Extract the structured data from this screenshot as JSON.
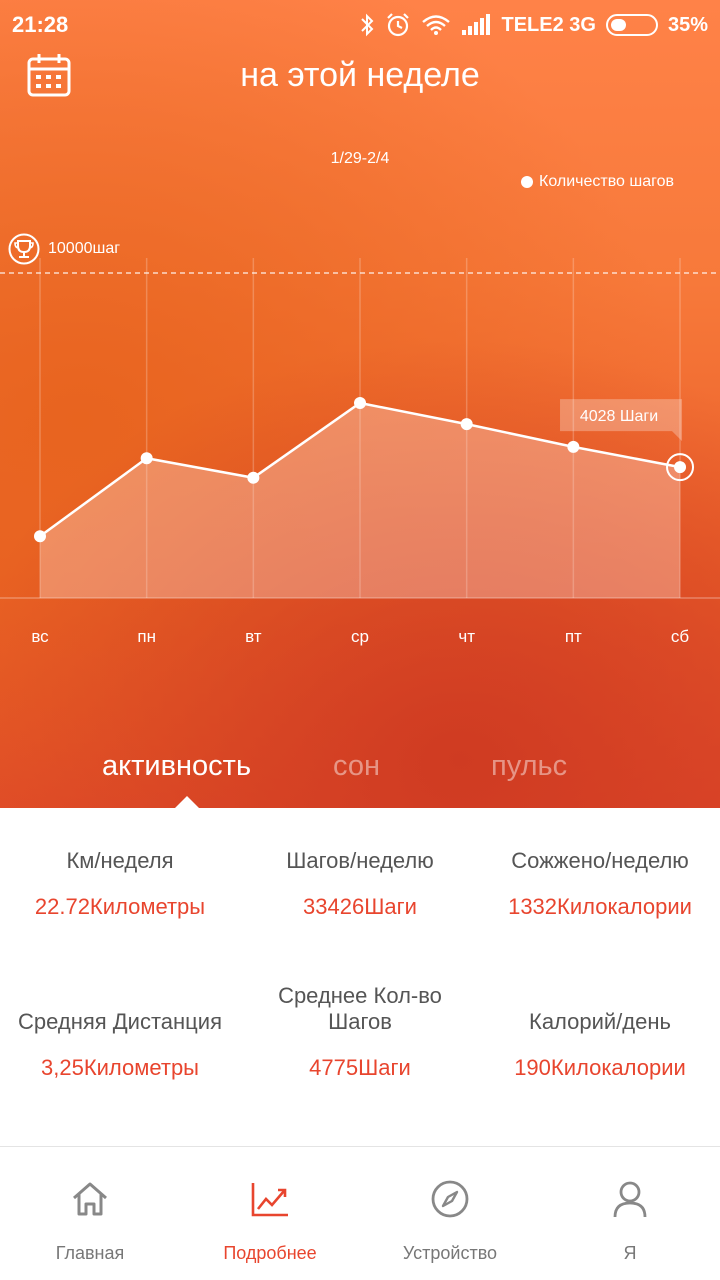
{
  "status_bar": {
    "time": "21:28",
    "carrier": "TELE2 3G",
    "battery": "35%",
    "battery_level": 0.35
  },
  "header": {
    "title": "на этой неделе",
    "calendar_icon": "calendar-icon"
  },
  "chart_data": {
    "type": "area",
    "date_range": "1/29-2/4",
    "legend": "Количество шагов",
    "goal_label": "10000шаг",
    "goal": 10000,
    "categories": [
      "вс",
      "пн",
      "вт",
      "ср",
      "чт",
      "пт",
      "сб"
    ],
    "series": [
      {
        "name": "Количество шагов",
        "values": [
          1900,
          4300,
          3700,
          6000,
          5350,
          4650,
          4028
        ]
      }
    ],
    "tooltip": "4028 Шаги",
    "selected_index": 6,
    "ylim": [
      0,
      10000
    ]
  },
  "tabs": [
    {
      "label": "активность",
      "active": true
    },
    {
      "label": "сон",
      "active": false
    },
    {
      "label": "пульс",
      "active": false
    }
  ],
  "stats": [
    {
      "label": "Км/неделя",
      "value": "22.72Километры"
    },
    {
      "label": "Шагов/неделю",
      "value": "33426Шаги"
    },
    {
      "label": "Сожжено/неделю",
      "value": "1332Килокалории"
    },
    {
      "label": "Средняя Дистанция",
      "value": "3,25Километры"
    },
    {
      "label": "Среднее Кол-во Шагов",
      "value": "4775Шаги"
    },
    {
      "label": "Калорий/день",
      "value": "190Килокалории"
    }
  ],
  "nav": [
    {
      "label": "Главная",
      "icon": "home-icon",
      "active": false
    },
    {
      "label": "Подробнее",
      "icon": "chart-icon",
      "active": true
    },
    {
      "label": "Устройство",
      "icon": "compass-icon",
      "active": false
    },
    {
      "label": "Я",
      "icon": "user-icon",
      "active": false
    }
  ],
  "colors": {
    "accent": "#e8452e",
    "hero_top": "#ff8248",
    "hero_bottom": "#d13d24"
  }
}
